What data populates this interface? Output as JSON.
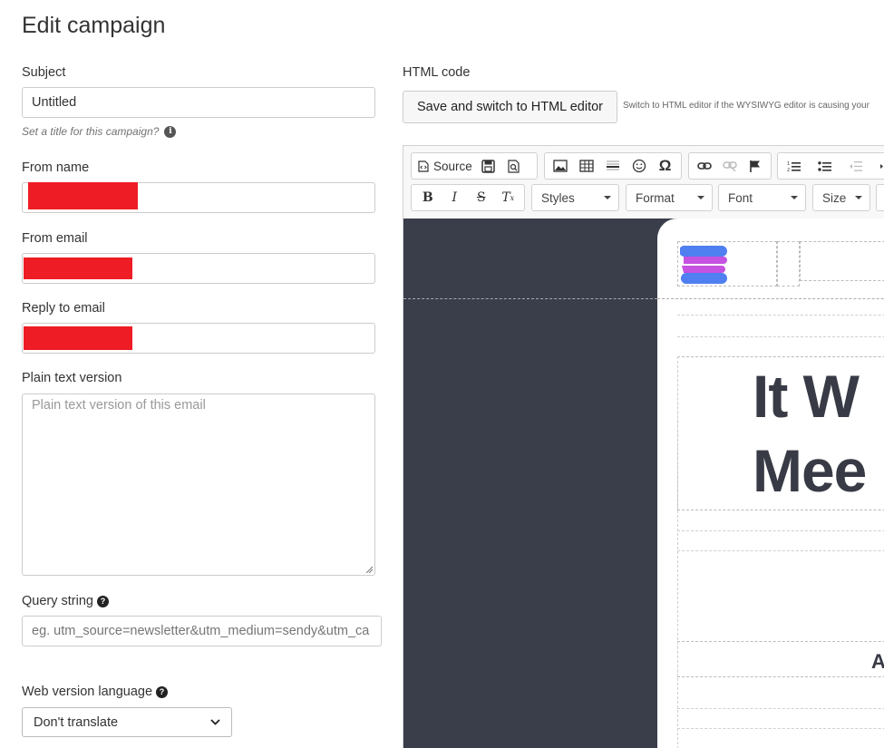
{
  "page": {
    "title": "Edit campaign"
  },
  "form": {
    "subject": {
      "label": "Subject",
      "value": "Untitled",
      "help": "Set a title for this campaign?"
    },
    "from_name": {
      "label": "From name"
    },
    "from_email": {
      "label": "From email"
    },
    "reply_to": {
      "label": "Reply to email"
    },
    "plain_text": {
      "label": "Plain text version",
      "placeholder": "Plain text version of this email"
    },
    "query_string": {
      "label": "Query string",
      "placeholder": "eg. utm_source=newsletter&utm_medium=sendy&utm_ca"
    },
    "web_version_language": {
      "label": "Web version language",
      "selected": "Don't translate"
    }
  },
  "html_code": {
    "label": "HTML code",
    "switch_button": "Save and switch to HTML editor",
    "switch_help": "Switch to HTML editor if the WYSIWYG editor is causing your"
  },
  "editor": {
    "toolbar": {
      "source_label": "Source",
      "styles_label": "Styles",
      "format_label": "Format",
      "font_label": "Font",
      "size_label": "Size"
    },
    "preview": {
      "headline_line1": "It W",
      "headline_line2": "Mee",
      "small_text": "A"
    },
    "colors": {
      "background": "#3a3d4a",
      "logo_pink": "#c552e0",
      "logo_blue": "#4f7ff0"
    }
  },
  "redaction_color": "#ee1c25"
}
